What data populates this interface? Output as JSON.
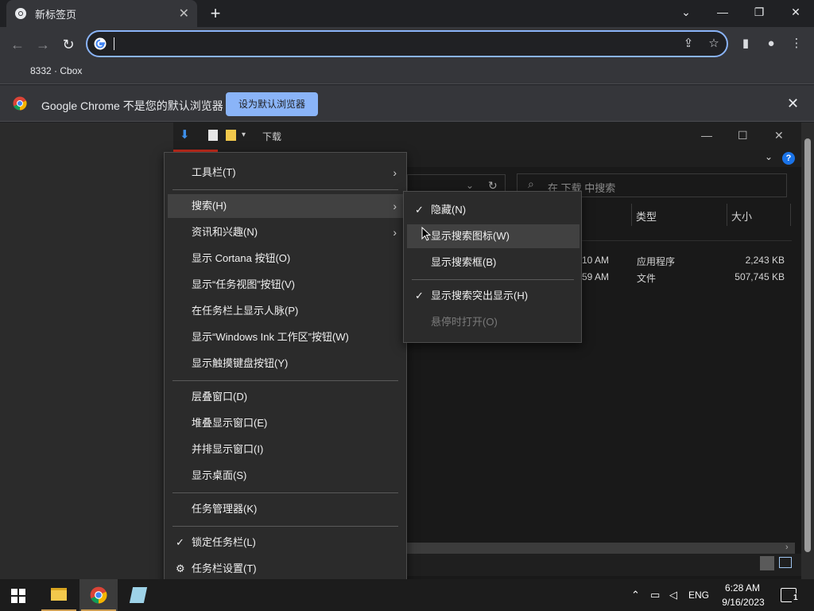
{
  "browser": {
    "tab_title": "新标签页",
    "tab_close": "✕",
    "new_tab": "+",
    "bookmark": "8332 · Cbox",
    "infobar_text": "Google Chrome 不是您的默认浏览器",
    "infobar_button": "设为默认浏览器",
    "infobar_close": "✕",
    "omnibox_value": ""
  },
  "explorer": {
    "title": "下载",
    "search_placeholder": "在 下载 中搜索",
    "columns": [
      "类型",
      "大小"
    ],
    "rows": [
      {
        "time": "10 AM",
        "type": "应用程序",
        "size": "2,243 KB"
      },
      {
        "time": "59 AM",
        "type": "文件",
        "size": "507,745 KB"
      }
    ]
  },
  "context_menu": {
    "items": [
      {
        "label": "工具栏(T)",
        "submenu": true
      },
      {
        "label": "搜索(H)",
        "submenu": true,
        "highlighted": true
      },
      {
        "label": "资讯和兴趣(N)",
        "submenu": true
      },
      {
        "label": "显示 Cortana 按钮(O)"
      },
      {
        "label": "显示“任务视图”按钮(V)"
      },
      {
        "label": "在任务栏上显示人脉(P)"
      },
      {
        "label": "显示“Windows Ink 工作区”按钮(W)"
      },
      {
        "label": "显示触摸键盘按钮(Y)"
      },
      {
        "label": "层叠窗口(D)"
      },
      {
        "label": "堆叠显示窗口(E)"
      },
      {
        "label": "并排显示窗口(I)"
      },
      {
        "label": "显示桌面(S)"
      },
      {
        "label": "任务管理器(K)"
      },
      {
        "label": "锁定任务栏(L)",
        "checked": true
      },
      {
        "label": "任务栏设置(T)",
        "icon": "gear-icon"
      }
    ]
  },
  "search_submenu": {
    "items": [
      {
        "label": "隐藏(N)",
        "checked": true
      },
      {
        "label": "显示搜索图标(W)",
        "highlighted": true
      },
      {
        "label": "显示搜索框(B)"
      },
      {
        "label": "显示搜索突出显示(H)",
        "checked": true
      },
      {
        "label": "悬停时打开(O)",
        "disabled": true
      }
    ]
  },
  "taskbar": {
    "language": "ENG",
    "time": "6:28 AM",
    "date": "9/16/2023",
    "notifications": "1"
  },
  "colors": {
    "accent": "#8ab4f8",
    "menu_bg": "#2b2b2b",
    "taskbar_bg": "#1c1c1c"
  }
}
